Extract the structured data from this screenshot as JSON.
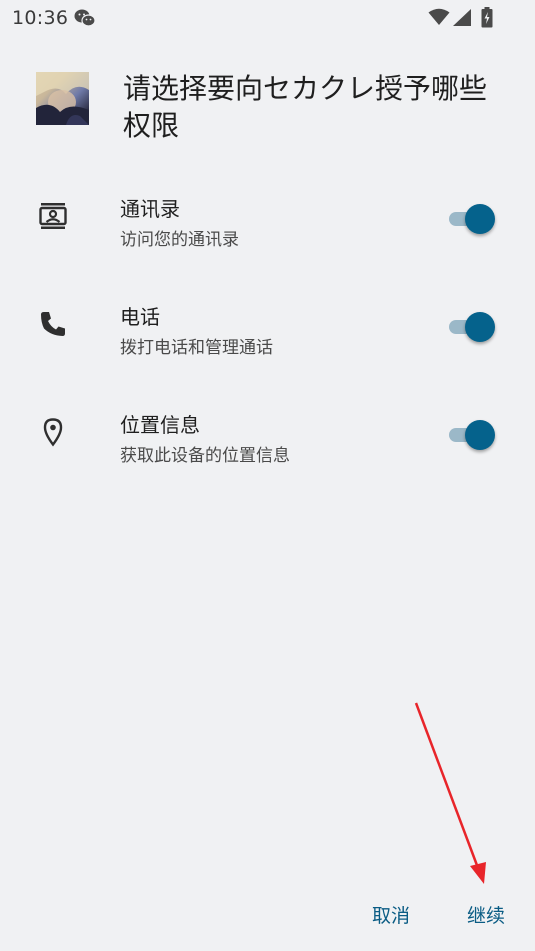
{
  "status_bar": {
    "time": "10:36",
    "left_icons": [
      "wechat-icon"
    ],
    "right_icons": [
      "wifi-icon",
      "signal-icon",
      "battery-charging-icon"
    ]
  },
  "dialog": {
    "title": "请选择要向セカクレ授予哪些权限",
    "permissions": [
      {
        "icon": "contacts-icon",
        "title": "通讯录",
        "subtitle": "访问您的通讯录",
        "enabled": true
      },
      {
        "icon": "phone-icon",
        "title": "电话",
        "subtitle": "拨打电话和管理通话",
        "enabled": true
      },
      {
        "icon": "location-icon",
        "title": "位置信息",
        "subtitle": "获取此设备的位置信息",
        "enabled": true
      }
    ],
    "cancel_label": "取消",
    "continue_label": "继续"
  },
  "colors": {
    "background": "#f0f1f3",
    "accent": "#05628c",
    "annotation": "#e8252a"
  }
}
